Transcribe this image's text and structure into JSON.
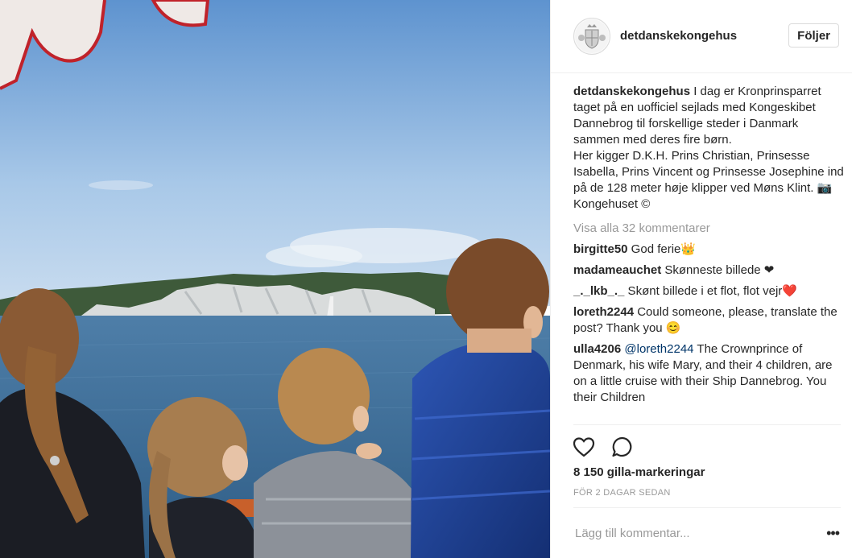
{
  "post": {
    "username": "detdanskekongehus",
    "follow_label": "Följer",
    "caption": {
      "username": "detdanskekongehus",
      "text": " I dag er Kronprinsparret taget på en uofficiel sejlads med Kongeskibet Dannebrog til forskellige steder i Danmark sammen med deres fire børn.\nHer kigger D.K.H. Prins Christian, Prinsesse Isabella, Prins Vincent og Prinsesse Josephine ind på de 128 meter høje klipper ved Møns Klint. 📷Kongehuset ©"
    },
    "view_all_comments": "Visa alla 32 kommentarer",
    "comments": [
      {
        "user": "birgitte50",
        "text": " God ferie👑",
        "mention": ""
      },
      {
        "user": "madameauchet",
        "text": " Skønneste billede ❤",
        "mention": ""
      },
      {
        "user": "_._lkb_._",
        "text": " Skønt billede i et flot, flot vejr❤️",
        "mention": ""
      },
      {
        "user": "loreth2244",
        "text": " Could someone, please, translate the post? Thank you 😊",
        "mention": ""
      },
      {
        "user": "ulla4206",
        "mention": " @loreth2244",
        "text": " The Crownprince of Denmark, his wife Mary, and their 4 children, are on a little cruise with their Ship Dannebrog. You their Children"
      }
    ],
    "likes": "8 150 gilla-markeringar",
    "time_ago": "FÖR 2 DAGAR SEDAN",
    "add_comment_placeholder": "Lägg till kommentar...",
    "more_options": "•••"
  },
  "icons": {
    "like": "heart-icon",
    "comment": "comment-bubble-icon",
    "avatar": "royal-crest-icon"
  },
  "colors": {
    "sky_top": "#6d9fd6",
    "sea": "#3e6e98",
    "jacket_blue": "#1d3e8c"
  }
}
